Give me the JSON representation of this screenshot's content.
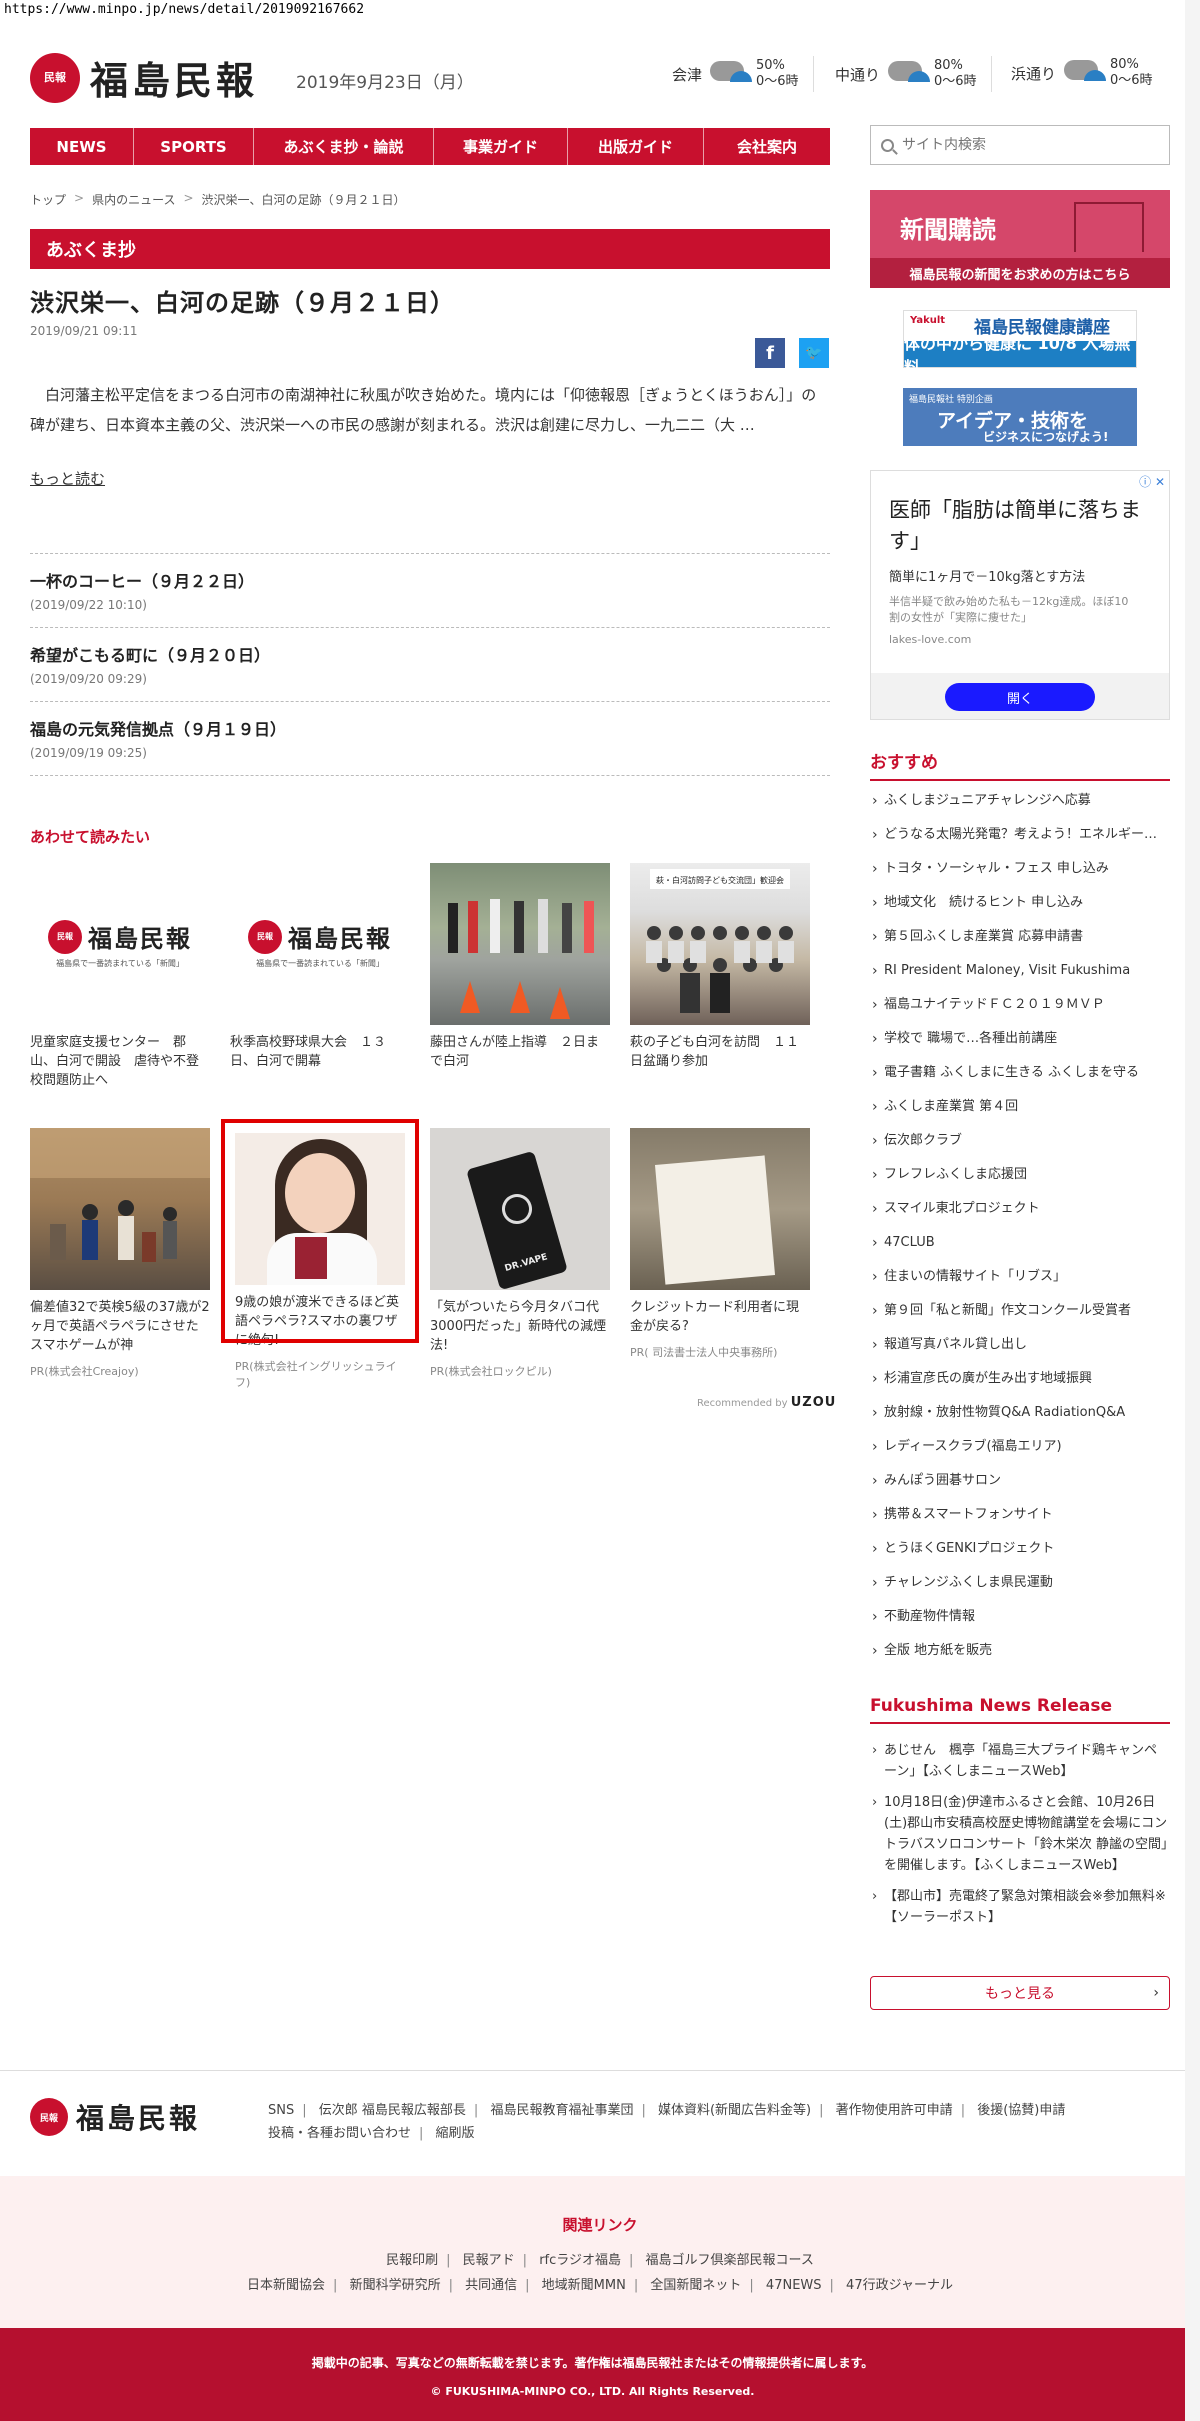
{
  "url": "https://www.minpo.jp/news/detail/2019092167662",
  "header": {
    "logo_mark": "民報",
    "logo_text": "福島民報",
    "date": "2019年9月23日（月）",
    "weather": [
      {
        "area": "会津",
        "pct": "50%",
        "time": "0〜6時"
      },
      {
        "area": "中通り",
        "pct": "80%",
        "time": "0〜6時"
      },
      {
        "area": "浜通り",
        "pct": "80%",
        "time": "0〜6時"
      }
    ]
  },
  "nav": [
    "NEWS",
    "SPORTS",
    "あぶくま抄・論説",
    "事業ガイド",
    "出版ガイド",
    "会社案内"
  ],
  "search": {
    "placeholder": "サイト内検索"
  },
  "breadcrumb": [
    "トップ",
    "県内のニュース",
    "渋沢栄一、白河の足跡（９月２１日）"
  ],
  "section": "あぶくま抄",
  "article": {
    "title": "渋沢栄一、白河の足跡（９月２１日）",
    "date": "2019/09/21 09:11",
    "body": "　白河藩主松平定信をまつる白河市の南湖神社に秋風が吹き始めた。境内には「仰徳報恩［ぎょうとくほうおん］」の碑が建ち、日本資本主義の父、渋沢栄一への市民の感謝が刻まれる。渋沢は創建に尽力し、一九二二（大 …",
    "readmore": "もっと読む"
  },
  "related": [
    {
      "title": "一杯のコーヒー（９月２２日）",
      "date": "(2019/09/22 10:10)"
    },
    {
      "title": "希望がこもる町に（９月２０日）",
      "date": "(2019/09/20 09:29)"
    },
    {
      "title": "福島の元気発信拠点（９月１９日）",
      "date": "(2019/09/19 09:25)"
    }
  ],
  "also_read": {
    "title": "あわせて読みたい",
    "logo_tag": "福島県で一番読まれている「新聞」",
    "cards": [
      {
        "caption": "児童家庭支援センター　郡山、白河で開設　虐待や不登校問題防止へ",
        "pr": ""
      },
      {
        "caption": "秋季高校野球県大会　１３日、白河で開幕",
        "pr": ""
      },
      {
        "caption": "藤田さんが陸上指導　２日まで白河",
        "pr": ""
      },
      {
        "caption": "萩の子ども白河を訪問　１１日盆踊り参加",
        "pr": ""
      },
      {
        "caption": "偏差値32で英検5級の37歳が2ヶ月で英語ペラペラにさせたスマホゲームが神",
        "pr": "PR(株式会社Creajoy)"
      },
      {
        "caption": "9歳の娘が渡米できるほど英語ペラペラ?スマホの裏ワザに絶句!",
        "pr": "PR(株式会社イングリッシュライフ)"
      },
      {
        "caption": "「気がついたら今月タバコ代3000円だった」新時代の減煙法!",
        "pr": "PR(株式会社ロックピル)"
      },
      {
        "caption": "クレジットカード利用者に現金が戻る?",
        "pr": "PR( 司法書士法人中央事務所)"
      }
    ],
    "group_photo_caption": "萩・白河訪問子ども交流団」歓迎会",
    "device_brand": "DR.VAPE",
    "recommended_label": "Recommended by",
    "recommended_brand": "UZOU"
  },
  "sidebar": {
    "subscribe": {
      "title": "新聞購読",
      "sub": "福島民報の新聞をお求めの方はこちら"
    },
    "ad_yakult": {
      "l1": "Yakult",
      "l2": "福島民報健康講座",
      "l3": "体の中から健康に 10/8 入場無料"
    },
    "ad_idea": {
      "l1": "福島民報社 特別企画",
      "l2": "アイデア・技術を",
      "l3": "ビジネスにつなげよう!"
    },
    "ad_box": {
      "close": "ⓘ ✕",
      "headline": "医師「脂肪は簡単に落ちます」",
      "p1": "簡単に1ヶ月で－10kg落とす方法",
      "p2": "半信半疑で飲み始めた私も－12kg達成。ほぼ10割の女性が「実際に痩せた」",
      "domain": "lakes-love.com",
      "button": "開く"
    },
    "recommend_title": "おすすめ",
    "recommend": [
      "ふくしまジュニアチャレンジへ応募",
      "どうなる太陽光発電？考えよう！エネルギーの未来",
      "トヨタ・ソーシャル・フェス 申し込み",
      "地域文化　続けるヒント 申し込み",
      "第５回ふくしま産業賞 応募申請書",
      "RI President Maloney, Visit Fukushima",
      "福島ユナイテッドＦＣ２０１９ＭＶＰ",
      "学校で 職場で…各種出前講座",
      "電子書籍 ふくしまに生きる ふくしまを守る",
      "ふくしま産業賞 第４回",
      "伝次郎クラブ",
      "フレフレふくしま応援団",
      "スマイル東北プロジェクト",
      "47CLUB",
      "住まいの情報サイト「リブス」",
      "第９回「私と新聞」作文コンクール受賞者",
      "報道写真パネル貸し出し",
      "杉浦宣彦氏の廣が生み出す地域振興",
      "放射線・放射性物質Q&A RadiationQ&A",
      "レディースクラブ(福島エリア)",
      "みんぽう囲碁サロン",
      "携帯＆スマートフォンサイト",
      "とうほくGENKIプロジェクト",
      "チャレンジふくしま県民運動",
      "不動産物件情報",
      "全版 地方紙を販売"
    ],
    "release_title": "Fukushima News Release",
    "releases": [
      "あじせん　楓亭「福島三大プライド鶏キャンペーン」【ふくしまニュースWeb】",
      "10月18日(金)伊達市ふるさと会館、10月26日(土)郡山市安積高校歴史博物館講堂を会場にコントラバスソロコンサート「鈴木栄次 静謐の空間」を開催します。【ふくしまニュースWeb】",
      "【郡山市】売電終了緊急対策相談会※参加無料※【ソーラーポスト】"
    ],
    "more": "もっと見る"
  },
  "footer": {
    "links": [
      "SNS",
      "伝次郎 福島民報広報部長",
      "福島民報教育福祉事業団",
      "媒体資料(新聞広告料金等)",
      "著作物使用許可申請",
      "後援(協賛)申請",
      "投稿・各種お問い合わせ",
      "縮刷版"
    ],
    "related_title": "関連リンク",
    "related_row1": [
      "民報印刷",
      "民報アド",
      "rfcラジオ福島",
      "福島ゴルフ倶楽部民報コース"
    ],
    "related_row2": [
      "日本新聞協会",
      "新聞科学研究所",
      "共同通信",
      "地域新聞MMN",
      "全国新聞ネット",
      "47NEWS",
      "47行政ジャーナル"
    ],
    "copy1": "掲載中の記事、写真などの無断転載を禁じます。著作権は福島民報社またはその情報提供者に属します。",
    "copy2": "© FUKUSHIMA-MINPO CO., LTD. All Rights Reserved."
  }
}
